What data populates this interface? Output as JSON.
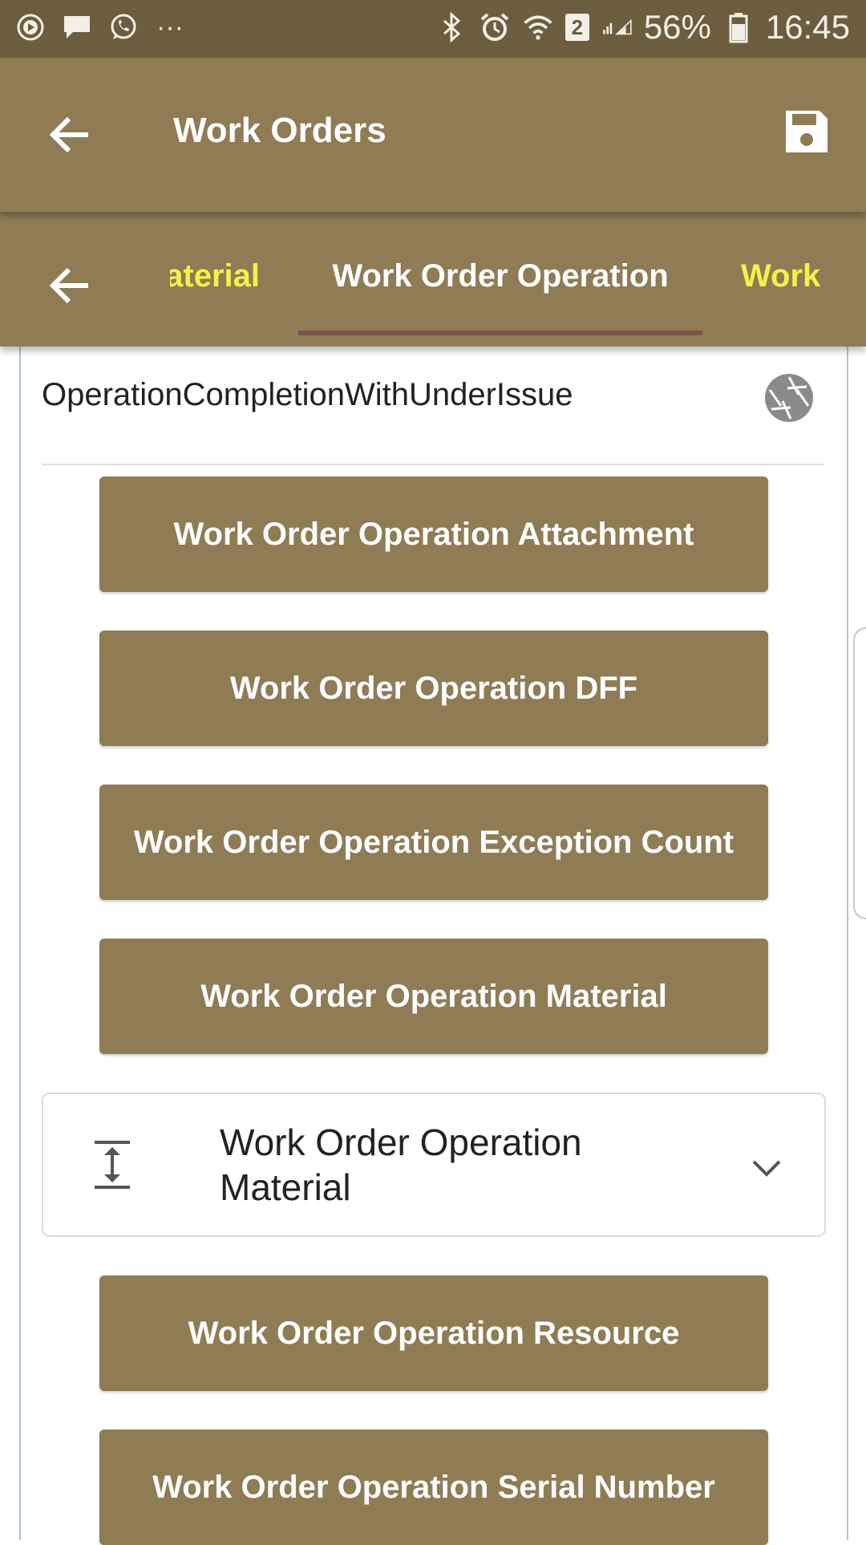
{
  "status_bar": {
    "left_icons": [
      "play-icon",
      "message-icon",
      "whatsapp-icon",
      "more-dots-icon"
    ],
    "more_dots": "···",
    "right_icons": [
      "bluetooth-icon",
      "alarm-icon",
      "wifi-icon",
      "sim2-icon",
      "signal-icon",
      "battery-icon"
    ],
    "sim_badge": "2",
    "battery": "56%",
    "time": "16:45"
  },
  "app_bar": {
    "title": "Work Orders",
    "back_icon": "arrow-left-icon",
    "save_icon": "save-icon"
  },
  "tabs": {
    "back_icon": "arrow-left-icon",
    "prev": "Material",
    "active": "Work Order Operation",
    "next": "Work",
    "prev_color": "#f2f24a",
    "active_color": "#ffffff",
    "underline_color": "#7a5449"
  },
  "operation": {
    "label": "OperationCompletionWithUnderIssue",
    "icon": "aperture-icon"
  },
  "buttons": [
    "Work Order Operation Attachment",
    "Work Order Operation DFF",
    "Work Order Operation Exception Count",
    "Work Order Operation Material"
  ],
  "expander": {
    "label": "Work Order Operation Material",
    "icon": "expand-vertical-icon",
    "chevron": "chevron-down-icon"
  },
  "buttons_after": [
    "Work Order Operation Resource",
    "Work Order Operation Serial Number"
  ],
  "colors": {
    "accent": "#8f7c55",
    "status_bar": "#6b5d3d",
    "border": "#a9cdb0"
  }
}
